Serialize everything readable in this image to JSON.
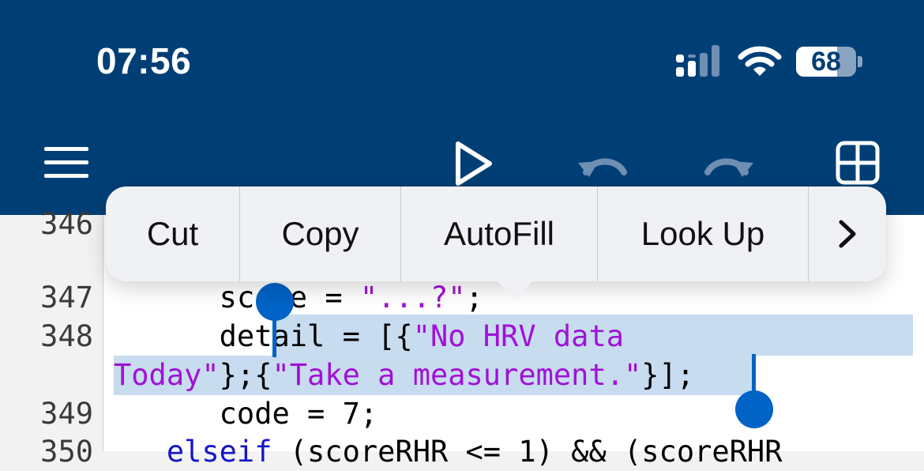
{
  "status_bar": {
    "time": "07:56",
    "battery": "68",
    "battery_level": 0.68
  },
  "toolbar": {
    "menu_icon": "hamburger-icon",
    "run_icon": "play-icon",
    "undo_icon": "undo-icon",
    "redo_icon": "redo-icon",
    "grid_icon": "grid-icon"
  },
  "context_menu": {
    "items": [
      "Cut",
      "Copy",
      "AutoFill",
      "Look Up"
    ],
    "more_icon": "chevron-right-icon"
  },
  "editor": {
    "line_numbers": [
      "346",
      "347",
      "348",
      "349",
      "350"
    ],
    "lines": {
      "l347": {
        "indent": "      ",
        "lead": "s",
        "text": "core = ",
        "str": "\"...?\"",
        "tail": ";"
      },
      "l348a": {
        "indent": "      ",
        "text": "detail = [{",
        "str": "\"No HRV data"
      },
      "l348b": {
        "str1": "Today\"",
        "mid": "};{",
        "str2": "\"Take a measurement.\"",
        "end": "}]",
        "tail": ";"
      },
      "l349": {
        "indent": "      ",
        "text": "code = 7;"
      },
      "l350": {
        "indent": "   ",
        "kw": "elseif",
        "text": " (scoreRHR <= 1) && (scoreRHR"
      }
    }
  },
  "colors": {
    "header": "#003f76",
    "string": "#a012d6",
    "keyword": "#1515c8",
    "selection": "#c8dcf0",
    "handle": "#0063c5"
  }
}
